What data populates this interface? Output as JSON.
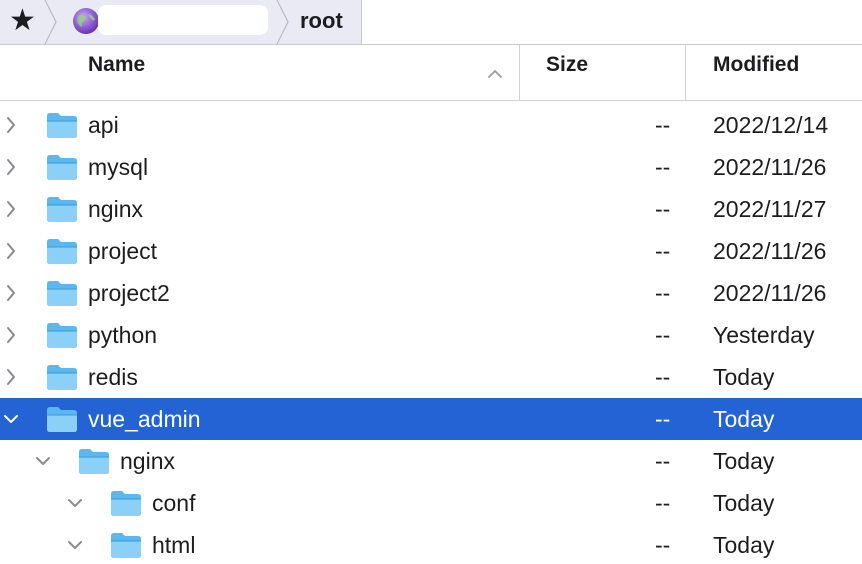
{
  "pathbar": {
    "favorites_icon": "star-icon",
    "server_icon": "globe-icon",
    "current_folder": "root"
  },
  "columns": {
    "name": "Name",
    "size": "Size",
    "modified": "Modified",
    "sort_icon": "chevron-up-icon"
  },
  "colors": {
    "selection": "#2463d3",
    "folder": "#5bb8ee",
    "pathbar_bg": "#e9eaf4"
  },
  "rows": [
    {
      "name": "api",
      "size": "--",
      "modified": "2022/12/14",
      "level": 0,
      "expanded": false,
      "selected": false
    },
    {
      "name": "mysql",
      "size": "--",
      "modified": "2022/11/26",
      "level": 0,
      "expanded": false,
      "selected": false
    },
    {
      "name": "nginx",
      "size": "--",
      "modified": "2022/11/27",
      "level": 0,
      "expanded": false,
      "selected": false
    },
    {
      "name": "project",
      "size": "--",
      "modified": "2022/11/26",
      "level": 0,
      "expanded": false,
      "selected": false
    },
    {
      "name": "project2",
      "size": "--",
      "modified": "2022/11/26",
      "level": 0,
      "expanded": false,
      "selected": false
    },
    {
      "name": "python",
      "size": "--",
      "modified": "Yesterday",
      "level": 0,
      "expanded": false,
      "selected": false
    },
    {
      "name": "redis",
      "size": "--",
      "modified": "Today",
      "level": 0,
      "expanded": false,
      "selected": false
    },
    {
      "name": "vue_admin",
      "size": "--",
      "modified": "Today",
      "level": 0,
      "expanded": true,
      "selected": true
    },
    {
      "name": "nginx",
      "size": "--",
      "modified": "Today",
      "level": 1,
      "expanded": true,
      "selected": false
    },
    {
      "name": "conf",
      "size": "--",
      "modified": "Today",
      "level": 2,
      "expanded": true,
      "selected": false
    },
    {
      "name": "html",
      "size": "--",
      "modified": "Today",
      "level": 2,
      "expanded": true,
      "selected": false
    }
  ]
}
